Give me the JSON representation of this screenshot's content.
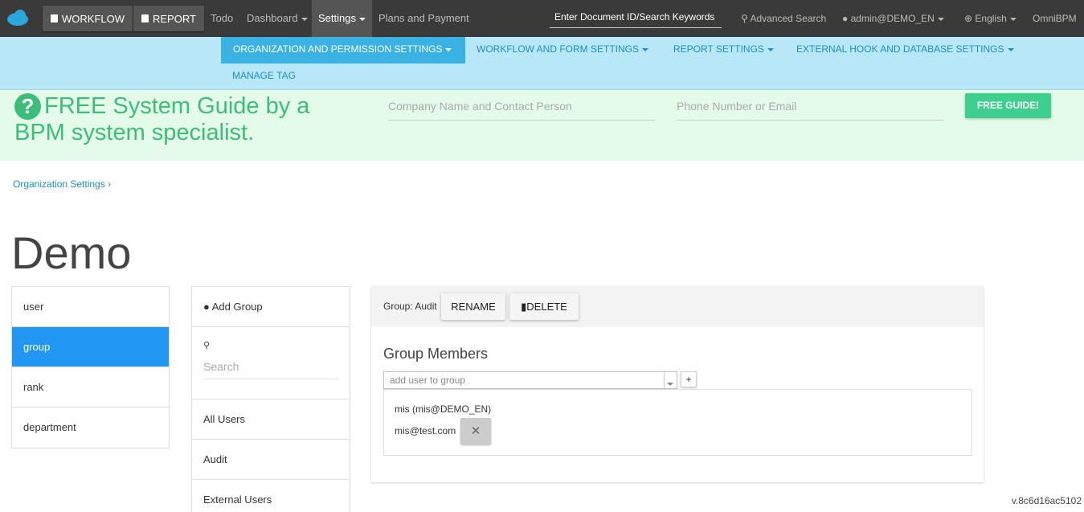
{
  "topbar": {
    "workflow_label": "WORKFLOW",
    "report_label": "REPORT",
    "todo": "Todo",
    "dashboard": "Dashboard",
    "settings": "Settings",
    "plans": "Plans and Payment",
    "search_placeholder": "Enter Document ID/Search Keywords",
    "advanced_search": "Advanced Search",
    "user": "admin@DEMO_EN",
    "language": "English",
    "brand": "OmniBPM"
  },
  "subnav": {
    "org": "ORGANIZATION AND PERMISSION SETTINGS",
    "workflow": "WORKFLOW AND FORM SETTINGS",
    "report": "REPORT SETTINGS",
    "external": "EXTERNAL HOOK AND DATABASE SETTINGS",
    "tag": "MANAGE TAG"
  },
  "banner": {
    "title": "FREE System Guide by a BPM system specialist.",
    "company_placeholder": "Company Name and Contact Person",
    "phone_placeholder": "Phone Number or Email",
    "button": "FREE GUIDE!"
  },
  "breadcrumb": "Organization Settings",
  "page_title": "Demo",
  "sidetabs": [
    "user",
    "group",
    "rank",
    "department"
  ],
  "grouplist": {
    "add_group": "Add Group",
    "search_placeholder": "Search",
    "items": [
      "All Users",
      "Audit",
      "External Users"
    ]
  },
  "panel": {
    "group_label": "Group: Audit",
    "rename": "RENAME",
    "delete": "DELETE",
    "members_title": "Group Members",
    "add_placeholder": "add user to group",
    "plus": "+",
    "members": [
      "mis (mis@DEMO_EN)",
      "mis@test.com"
    ]
  },
  "version": "v.8c6d16ac5102",
  "colors": {
    "topbar": "#3a3a3a",
    "subnav": "#b8e8f8",
    "active_tab": "#2196f3",
    "banner_green": "#3cbd7a"
  }
}
